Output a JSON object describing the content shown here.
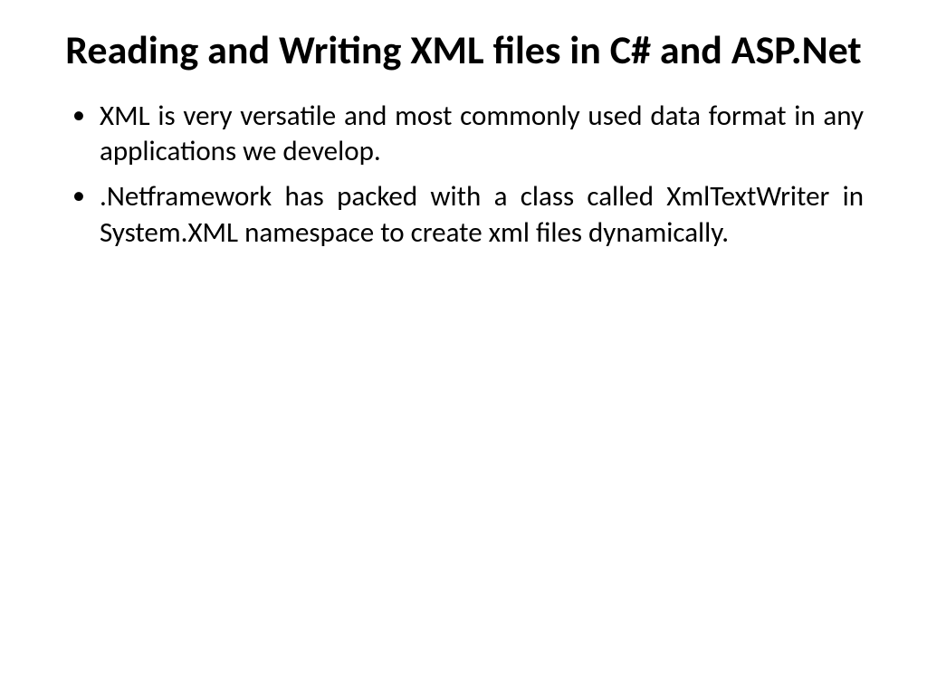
{
  "slide": {
    "title": "Reading and Writing XML files in C# and ASP.Net",
    "bullets": [
      "XML is very versatile and most commonly used data format in any applications we develop.",
      ".Netframework has packed with a class called XmlTextWriter in System.XML namespace to create xml files dynamically."
    ]
  }
}
